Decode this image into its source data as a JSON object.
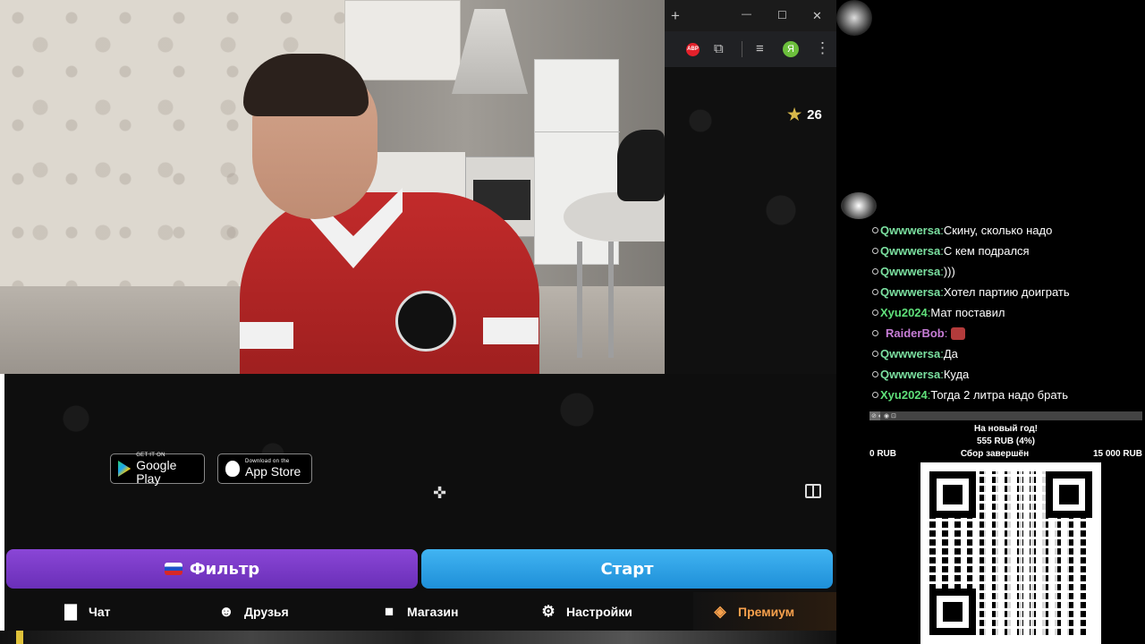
{
  "browser": {
    "new_tab_glyph": "+",
    "minimize_glyph": "—",
    "maximize_glyph": "☐",
    "close_glyph": "✕",
    "adblock_label": "ABP",
    "extensions_glyph": "⧉",
    "media_glyph": "≡",
    "profile_initial": "Я",
    "menu_glyph": "⋮"
  },
  "app": {
    "stars_count": "26",
    "google_play": {
      "small": "GET IT ON",
      "big": "Google Play"
    },
    "app_store": {
      "small": "Download on the",
      "big": "App Store"
    },
    "filter_label": "Фильтр",
    "start_label": "Старт",
    "nav": [
      {
        "label": "Чат",
        "icon": "chat-icon"
      },
      {
        "label": "Друзья",
        "icon": "friends-icon"
      },
      {
        "label": "Магазин",
        "icon": "shop-bag-icon"
      },
      {
        "label": "Настройки",
        "icon": "gear-icon"
      },
      {
        "label": "Премиум",
        "icon": "tag-icon"
      }
    ],
    "colors": {
      "filter": "#7b3bc9",
      "start": "#33a6ec",
      "premium": "#f7a04c",
      "star": "#d8b84a"
    }
  },
  "chat": {
    "messages": [
      {
        "user": "Qwwwersa",
        "color": "#7be0a0",
        "text": "Скину, сколько надо"
      },
      {
        "user": "Qwwwersa",
        "color": "#7be0a0",
        "text": "С кем подрался"
      },
      {
        "user": "Qwwwersa",
        "color": "#7be0a0",
        "text": ")))"
      },
      {
        "user": "Qwwwersa",
        "color": "#7be0a0",
        "text": "Хотел партию доиграть"
      },
      {
        "user": "Xyu2024",
        "color": "#5fe07a",
        "text": "Мат поставил"
      },
      {
        "user": "RaiderBob",
        "color": "#c77dd6",
        "text": ""
      },
      {
        "user": "Qwwwersa",
        "color": "#7be0a0",
        "text": "Да"
      },
      {
        "user": "Qwwwersa",
        "color": "#7be0a0",
        "text": "Куда"
      },
      {
        "user": "Xyu2024",
        "color": "#5fe07a",
        "text": "Тогда 2 литра надо брать"
      }
    ]
  },
  "goal": {
    "title": "На новый год!",
    "raised": "555 RUB (4%)",
    "progress_fraction": 0.04,
    "min": "0 RUB",
    "status": "Сбор завершён",
    "max": "15 000 RUB"
  }
}
